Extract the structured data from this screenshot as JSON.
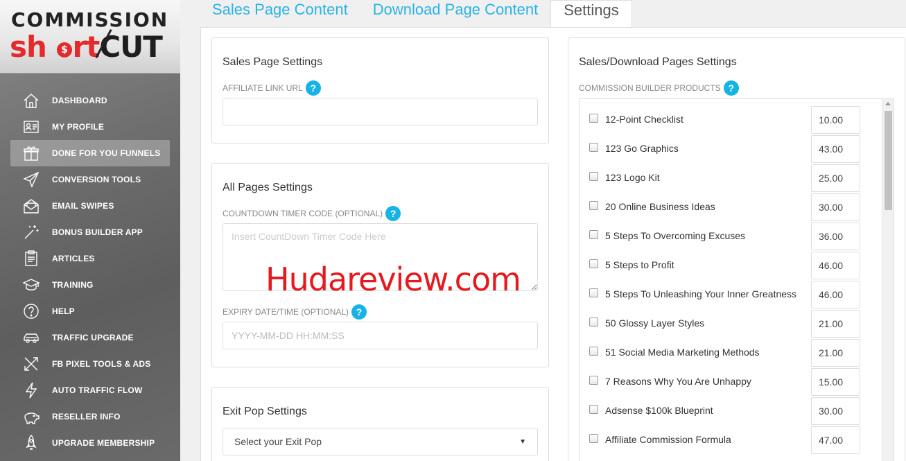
{
  "brand": {
    "line1": "COMMISSION",
    "short": "short",
    "cut": "CUT",
    "dollar": "$"
  },
  "nav": [
    {
      "label": "DASHBOARD",
      "icon": "house-icon"
    },
    {
      "label": "MY PROFILE",
      "icon": "id-card-icon"
    },
    {
      "label": "DONE FOR YOU FUNNELS",
      "icon": "gift-icon",
      "active": true
    },
    {
      "label": "CONVERSION TOOLS",
      "icon": "paper-plane-icon"
    },
    {
      "label": "EMAIL SWIPES",
      "icon": "envelope-icon"
    },
    {
      "label": "BONUS BUILDER APP",
      "icon": "magic-wand-icon"
    },
    {
      "label": "ARTICLES",
      "icon": "clipboard-icon"
    },
    {
      "label": "TRAINING",
      "icon": "graduation-cap-icon"
    },
    {
      "label": "HELP",
      "icon": "question-circle-icon"
    },
    {
      "label": "TRAFFIC UPGRADE",
      "icon": "car-icon"
    },
    {
      "label": "FB PIXEL TOOLS & ADS",
      "icon": "crossed-arrows-icon"
    },
    {
      "label": "AUTO TRAFFIC FLOW",
      "icon": "lightning-icon"
    },
    {
      "label": "RESELLER INFO",
      "icon": "piggy-bank-icon"
    },
    {
      "label": "UPGRADE MEMBERSHIP",
      "icon": "rocket-icon"
    }
  ],
  "tabs": [
    {
      "label": "Sales Page Content"
    },
    {
      "label": "Download Page Content"
    },
    {
      "label": "Settings",
      "active": true
    }
  ],
  "sales_settings": {
    "title": "Sales Page Settings",
    "affiliate_label": "AFFILIATE LINK URL",
    "affiliate_value": ""
  },
  "all_pages": {
    "title": "All Pages Settings",
    "countdown_label": "COUNTDOWN TIMER CODE (OPTIONAL)",
    "countdown_placeholder": "Insert CountDown Timer Code Here",
    "expiry_label": "EXPIRY DATE/TIME (OPTIONAL)",
    "expiry_placeholder": "YYYY-MM-DD HH:MM:SS"
  },
  "exit_pop": {
    "title": "Exit Pop Settings",
    "selected": "Select your Exit Pop"
  },
  "products_section": {
    "title": "Sales/Download Pages Settings",
    "label": "COMMISSION BUILDER PRODUCTS",
    "items": [
      {
        "name": "12-Point Checklist",
        "price": "10.00"
      },
      {
        "name": "123 Go Graphics",
        "price": "43.00"
      },
      {
        "name": "123 Logo Kit",
        "price": "25.00"
      },
      {
        "name": "20 Online Business Ideas",
        "price": "30.00"
      },
      {
        "name": "5 Steps To Overcoming Excuses",
        "price": "36.00"
      },
      {
        "name": "5 Steps to Profit",
        "price": "46.00"
      },
      {
        "name": "5 Steps To Unleashing Your Inner Greatness",
        "price": "46.00"
      },
      {
        "name": "50 Glossy Layer Styles",
        "price": "21.00"
      },
      {
        "name": "51 Social Media Marketing Methods",
        "price": "21.00"
      },
      {
        "name": "7 Reasons Why You Are Unhappy",
        "price": "15.00"
      },
      {
        "name": "Adsense $100k Blueprint",
        "price": "30.00"
      },
      {
        "name": "Affiliate Commission Formula",
        "price": "47.00"
      }
    ]
  },
  "help_glyph": "?",
  "watermark": "Hudareview.com"
}
